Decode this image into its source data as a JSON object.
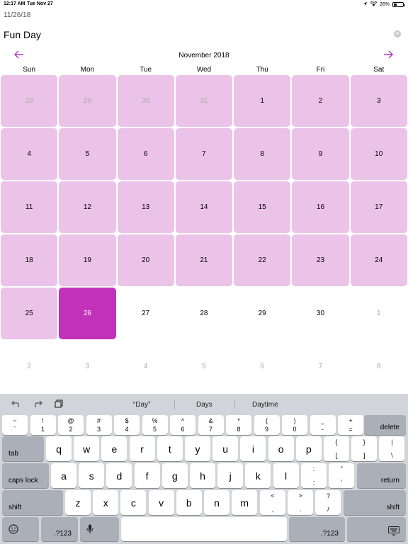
{
  "status_bar": {
    "time": "12:17 AM",
    "date": "Tue Nov 27",
    "battery": "26%",
    "battery_level": 0.26
  },
  "form": {
    "date_value": "11/26/18",
    "title_value": "Fun Day"
  },
  "calendar": {
    "month_label": "November 2018",
    "weekdays": [
      "Sun",
      "Mon",
      "Tue",
      "Wed",
      "Thu",
      "Fri",
      "Sat"
    ],
    "weeks": [
      [
        {
          "d": "28",
          "other": true,
          "tint": true
        },
        {
          "d": "29",
          "other": true,
          "tint": true
        },
        {
          "d": "30",
          "other": true,
          "tint": true
        },
        {
          "d": "31",
          "other": true,
          "tint": true
        },
        {
          "d": "1",
          "tint": true
        },
        {
          "d": "2",
          "tint": true
        },
        {
          "d": "3",
          "tint": true
        }
      ],
      [
        {
          "d": "4",
          "tint": true
        },
        {
          "d": "5",
          "tint": true
        },
        {
          "d": "6",
          "tint": true
        },
        {
          "d": "7",
          "tint": true
        },
        {
          "d": "8",
          "tint": true
        },
        {
          "d": "9",
          "tint": true
        },
        {
          "d": "10",
          "tint": true
        }
      ],
      [
        {
          "d": "11",
          "tint": true
        },
        {
          "d": "12",
          "tint": true
        },
        {
          "d": "13",
          "tint": true
        },
        {
          "d": "14",
          "tint": true
        },
        {
          "d": "15",
          "tint": true
        },
        {
          "d": "16",
          "tint": true
        },
        {
          "d": "17",
          "tint": true
        }
      ],
      [
        {
          "d": "18",
          "tint": true
        },
        {
          "d": "19",
          "tint": true
        },
        {
          "d": "20",
          "tint": true
        },
        {
          "d": "21",
          "tint": true
        },
        {
          "d": "22",
          "tint": true
        },
        {
          "d": "23",
          "tint": true
        },
        {
          "d": "24",
          "tint": true
        }
      ],
      [
        {
          "d": "25",
          "tint": true
        },
        {
          "d": "26",
          "selected": true
        },
        {
          "d": "27"
        },
        {
          "d": "28"
        },
        {
          "d": "29"
        },
        {
          "d": "30"
        },
        {
          "d": "1",
          "other": true
        }
      ],
      [
        {
          "d": "2",
          "other": true
        },
        {
          "d": "3",
          "other": true
        },
        {
          "d": "4",
          "other": true
        },
        {
          "d": "5",
          "other": true
        },
        {
          "d": "6",
          "other": true
        },
        {
          "d": "7",
          "other": true
        },
        {
          "d": "8",
          "other": true
        }
      ]
    ]
  },
  "colors": {
    "accent": "#b433c0",
    "tint": "#ebc3e8",
    "selected": "#c232b8"
  },
  "keyboard": {
    "suggestions": [
      "“Day”",
      "Days",
      "Daytime"
    ],
    "tools": [
      "undo-icon",
      "redo-icon",
      "paste-icon"
    ],
    "number_row": [
      {
        "top": "~",
        "bot": "`"
      },
      {
        "top": "!",
        "bot": "1"
      },
      {
        "top": "@",
        "bot": "2"
      },
      {
        "top": "#",
        "bot": "3"
      },
      {
        "top": "$",
        "bot": "4"
      },
      {
        "top": "%",
        "bot": "5"
      },
      {
        "top": "^",
        "bot": "6"
      },
      {
        "top": "&",
        "bot": "7"
      },
      {
        "top": "*",
        "bot": "8"
      },
      {
        "top": "(",
        "bot": "9"
      },
      {
        "top": ")",
        "bot": "0"
      },
      {
        "top": "_",
        "bot": "-"
      },
      {
        "top": "+",
        "bot": "="
      }
    ],
    "delete_label": "delete",
    "tab_label": "tab",
    "row_q": [
      "q",
      "w",
      "e",
      "r",
      "t",
      "y",
      "u",
      "i",
      "o",
      "p"
    ],
    "row_q_symbols": [
      {
        "top": "{",
        "bot": "["
      },
      {
        "top": "}",
        "bot": "]"
      },
      {
        "top": "|",
        "bot": "\\"
      }
    ],
    "caps_label": "caps lock",
    "row_a": [
      "a",
      "s",
      "d",
      "f",
      "g",
      "h",
      "j",
      "k",
      "l"
    ],
    "row_a_symbols": [
      {
        "top": ":",
        "bot": ";"
      },
      {
        "top": "”",
        "bot": "’"
      }
    ],
    "return_label": "return",
    "shift_label": "shift",
    "row_z": [
      "z",
      "x",
      "c",
      "v",
      "b",
      "n",
      "m"
    ],
    "row_z_symbols": [
      {
        "top": "<",
        "bot": ","
      },
      {
        "top": ">",
        "bot": "."
      },
      {
        "top": "?",
        "bot": "/"
      }
    ],
    "numbers_label": ".?123"
  }
}
